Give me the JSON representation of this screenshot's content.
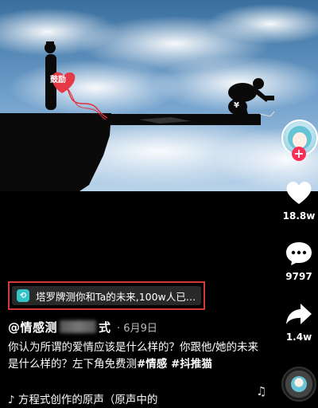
{
  "scene": {
    "badge_text": "鼓励",
    "yen_symbol": "¥"
  },
  "sidebar": {
    "like_count": "18.8w",
    "comment_count": "9797",
    "share_count": "1.4w",
    "follow_symbol": "+"
  },
  "tarot_link": {
    "icon_glyph": "⟲",
    "text": "塔罗牌测你和Ta的未来,100w人已…"
  },
  "post": {
    "author_prefix": "@情感测",
    "author_suffix": "式",
    "date": "· 6月9日",
    "description": "你认为所谓的爱情应该是什么样的？你跟他/她的未来是什么样的？左下角免费测",
    "hashtags": "#情感 #抖推猫",
    "music": "♪ 方程式创作的原声（原声中的"
  },
  "colors": {
    "accent": "#fe2c55",
    "highlight_border": "#d23a3a",
    "tarot_icon": "#33c4c8"
  }
}
